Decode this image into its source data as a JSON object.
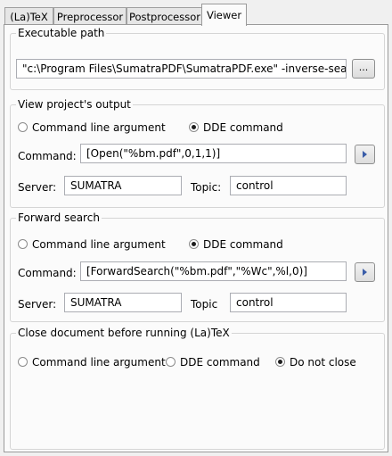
{
  "tabs": [
    {
      "label": "(La)TeX"
    },
    {
      "label": "Preprocessor"
    },
    {
      "label": "Postprocessor"
    },
    {
      "label": "Viewer"
    }
  ],
  "executable": {
    "legend": "Executable path",
    "path_value": "\"c:\\Program Files\\SumatraPDF\\SumatraPDF.exe\" -inverse-search \"\\\"",
    "browse_label": "..."
  },
  "view_output": {
    "legend": "View project's output",
    "option_cmdline": "Command line argument",
    "option_dde": "DDE command",
    "command_label": "Command:",
    "command_value": "[Open(\"%bm.pdf\",0,1,1)]",
    "server_label": "Server:",
    "server_value": "SUMATRA",
    "topic_label": "Topic:",
    "topic_value": "control"
  },
  "forward_search": {
    "legend": "Forward search",
    "option_cmdline": "Command line argument",
    "option_dde": "DDE command",
    "command_label": "Command:",
    "command_value": "[ForwardSearch(\"%bm.pdf\",\"%Wc\",%l,0)]",
    "server_label": "Server:",
    "server_value": "SUMATRA",
    "topic_label": "Topic",
    "topic_value": "control"
  },
  "close_doc": {
    "legend": "Close document before running (La)TeX",
    "option_cmdline": "Command line argument",
    "option_dde": "DDE command",
    "option_none": "Do not close"
  }
}
